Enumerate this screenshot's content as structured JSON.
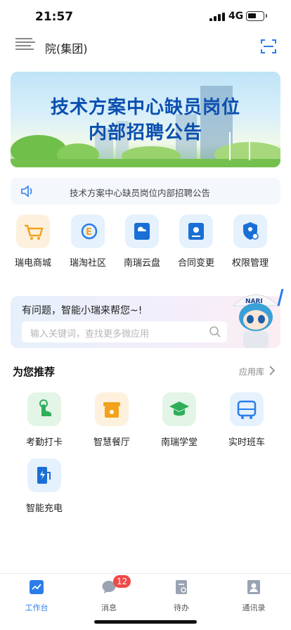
{
  "status_bar": {
    "time": "21:57",
    "network": "4G"
  },
  "header": {
    "org_name": "院(集团)"
  },
  "banner": {
    "line1": "技术方案中心缺员岗位",
    "line2": "内部招聘公告"
  },
  "notice": {
    "text": "技术方案中心缺员岗位内部招聘公告"
  },
  "apps": [
    {
      "label": "瑞电商城",
      "icon": "cart-icon"
    },
    {
      "label": "瑞淘社区",
      "icon": "community-icon"
    },
    {
      "label": "南瑞云盘",
      "icon": "cloud-disk-icon"
    },
    {
      "label": "合同变更",
      "icon": "contract-icon"
    },
    {
      "label": "权限管理",
      "icon": "permission-icon"
    }
  ],
  "ai_assistant": {
    "title": "有问题，智能小瑞来帮您~!",
    "search_placeholder": "输入关键词，查找更多微应用",
    "mascot_label": "NARI"
  },
  "recommend": {
    "title": "为您推荐",
    "more": "应用库",
    "items": [
      {
        "label": "考勤打卡",
        "icon": "tap-icon"
      },
      {
        "label": "智慧餐厅",
        "icon": "canteen-icon"
      },
      {
        "label": "南瑞学堂",
        "icon": "graduation-icon"
      },
      {
        "label": "实时班车",
        "icon": "bus-icon"
      },
      {
        "label": "智能充电",
        "icon": "charging-icon"
      }
    ]
  },
  "tabbar": {
    "tabs": [
      {
        "label": "工作台",
        "active": true
      },
      {
        "label": "消息",
        "active": false
      },
      {
        "label": "待办",
        "active": false
      },
      {
        "label": "通讯录",
        "active": false
      }
    ],
    "message_badge": "12"
  },
  "colors": {
    "accent": "#2b7de9",
    "badge": "#f04848",
    "banner_title": "#0a4fb0"
  }
}
